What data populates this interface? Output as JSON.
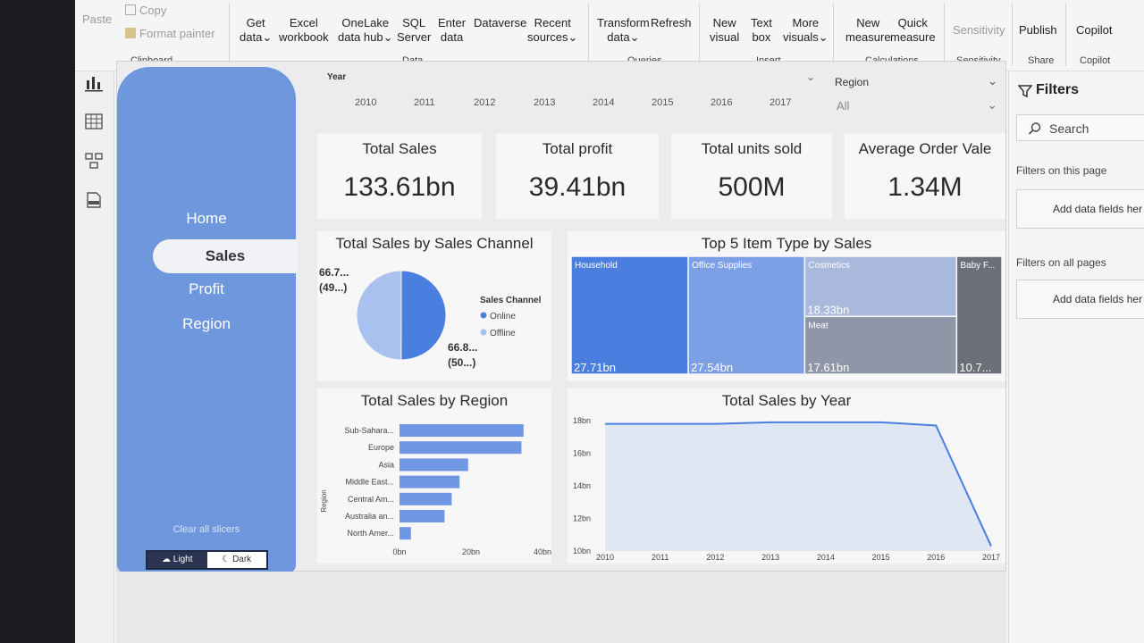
{
  "ribbon": {
    "clipboard": {
      "paste": "Paste",
      "copy": "Copy",
      "format_painter": "Format painter",
      "label": "Clipboard"
    },
    "data": {
      "get_data": [
        "Get",
        "data"
      ],
      "excel": [
        "Excel",
        "workbook"
      ],
      "onelake": [
        "OneLake",
        "data hub"
      ],
      "sql": [
        "SQL",
        "Server"
      ],
      "enter": [
        "Enter",
        "data"
      ],
      "dataverse": [
        "Dataverse"
      ],
      "recent": [
        "Recent",
        "sources"
      ],
      "label": "Data"
    },
    "queries": {
      "transform": [
        "Transform",
        "data"
      ],
      "refresh": "Refresh",
      "label": "Queries"
    },
    "insert": {
      "new_visual": [
        "New",
        "visual"
      ],
      "text_box": [
        "Text",
        "box"
      ],
      "more_visuals": [
        "More",
        "visuals"
      ],
      "label": "Insert"
    },
    "calculations": {
      "new_measure": [
        "New",
        "measure"
      ],
      "quick_measure": [
        "Quick",
        "measure"
      ],
      "label": "Calculations"
    },
    "sensitivity": {
      "btn": "Sensitivity",
      "label": "Sensitivity"
    },
    "share": {
      "publish": "Publish",
      "label": "Share"
    },
    "copilot": {
      "btn": "Copilot",
      "label": "Copilot"
    }
  },
  "nav": {
    "home": "Home",
    "sales": "Sales",
    "profit": "Profit",
    "region": "Region",
    "clear": "Clear all slicers",
    "light": "Light",
    "dark": "Dark"
  },
  "year_slicer": {
    "label": "Year",
    "years": [
      "2010",
      "2011",
      "2012",
      "2013",
      "2014",
      "2015",
      "2016",
      "2017"
    ]
  },
  "region_slicer": {
    "label": "Region",
    "value": "All"
  },
  "cards": [
    {
      "title": "Total Sales",
      "value": "133.61bn"
    },
    {
      "title": "Total profit",
      "value": "39.41bn"
    },
    {
      "title": "Total units sold",
      "value": "500M"
    },
    {
      "title": "Average Order Vale",
      "value": "1.34M"
    }
  ],
  "filters": {
    "title": "Filters",
    "search": "Search",
    "on_page": "Filters on this page",
    "on_all": "Filters on all pages",
    "add_fields": "Add data fields her"
  },
  "chart_data": [
    {
      "type": "pie",
      "title": "Total Sales by Sales Channel",
      "legend_title": "Sales Channel",
      "legend_position": "right",
      "categories": [
        "Online",
        "Offline"
      ],
      "values": [
        66.8,
        66.7
      ],
      "data_labels": [
        [
          "66.8...",
          "(50...)"
        ],
        [
          "66.7...",
          "(49...)"
        ]
      ],
      "colors": [
        "#4a7fe0",
        "#a9c1ee"
      ]
    },
    {
      "type": "treemap",
      "title": "Top 5 Item Type by Sales",
      "categories": [
        "Household",
        "Office Supplies",
        "Cosmetics",
        "Meat",
        "Baby F..."
      ],
      "values": [
        27.71,
        27.54,
        18.33,
        17.61,
        10.7
      ],
      "data_labels": [
        "27.71bn",
        "27.54bn",
        "18.33bn",
        "17.61bn",
        "10.7..."
      ],
      "colors": [
        "#4a7fe0",
        "#7c9fe6",
        "#a9b9de",
        "#8f96a8",
        "#6b6f78"
      ]
    },
    {
      "type": "bar",
      "orientation": "horizontal",
      "title": "Total Sales by Region",
      "ylabel": "Region",
      "categories": [
        "Sub-Sahara...",
        "Europe",
        "Asia",
        "Middle East...",
        "Central Am...",
        "Australia an...",
        "North Amer..."
      ],
      "values": [
        34.7,
        34.1,
        19.2,
        16.8,
        14.6,
        12.6,
        3.2
      ],
      "xticks": [
        "0bn",
        "20bn",
        "40bn"
      ],
      "xlim": [
        0,
        40
      ],
      "color": "#6f97e4"
    },
    {
      "type": "area",
      "title": "Total Sales by Year",
      "x": [
        "2010",
        "2011",
        "2012",
        "2013",
        "2014",
        "2015",
        "2016",
        "2017"
      ],
      "values": [
        17.8,
        17.8,
        17.8,
        17.9,
        17.9,
        17.9,
        17.7,
        10.3
      ],
      "yticks": [
        "10bn",
        "12bn",
        "14bn",
        "16bn",
        "18bn"
      ],
      "ylim": [
        10,
        18
      ],
      "color": "#4a7fe0"
    }
  ]
}
